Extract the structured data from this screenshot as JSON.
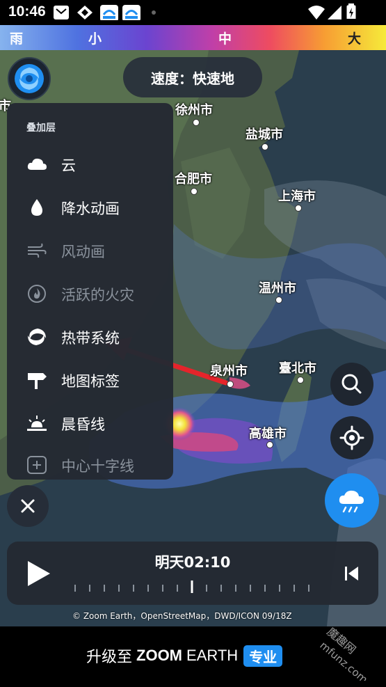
{
  "status_bar": {
    "time": "10:46"
  },
  "legend": {
    "labels": [
      "雨",
      "小",
      "中",
      "大"
    ]
  },
  "top": {
    "speed_label": "速度：快速地"
  },
  "map": {
    "cities": [
      "徐州市",
      "盐城市",
      "合肥市",
      "上海市",
      "温州市",
      "泉州市",
      "臺北市",
      "高雄市"
    ],
    "edge_city_fragment": "市"
  },
  "layers_panel": {
    "title": "叠加层",
    "items": [
      {
        "label": "云",
        "icon": "cloud-icon",
        "enabled": true
      },
      {
        "label": "降水动画",
        "icon": "raindrop-icon",
        "enabled": true
      },
      {
        "label": "风动画",
        "icon": "wind-icon",
        "enabled": false
      },
      {
        "label": "活跃的火灾",
        "icon": "fire-icon",
        "enabled": false
      },
      {
        "label": "热带系统",
        "icon": "hurricane-icon",
        "enabled": true
      },
      {
        "label": "地图标签",
        "icon": "signpost-icon",
        "enabled": true
      },
      {
        "label": "晨昏线",
        "icon": "sunrise-icon",
        "enabled": true
      },
      {
        "label": "中心十字线",
        "icon": "crosshair-box-icon",
        "enabled": false
      }
    ]
  },
  "controls": {
    "close_icon": "close-icon",
    "search_icon": "search-icon",
    "locate_icon": "locate-icon",
    "rain_icon": "rain-cloud-icon"
  },
  "timeline": {
    "time_label": "明天02:10"
  },
  "attribution": "© Zoom Earth，OpenStreetMap，DWD/ICON 09/18Z",
  "upgrade": {
    "prefix": "升级至",
    "brand_bold": "ZOOM",
    "brand_rest": "EARTH",
    "badge": "专业"
  },
  "watermark": "魔趣网 mfunz.com",
  "colors": {
    "accent_blue": "#1f8ef0",
    "panel_bg": "#242933",
    "annotation_arrow": "#e5242b"
  }
}
